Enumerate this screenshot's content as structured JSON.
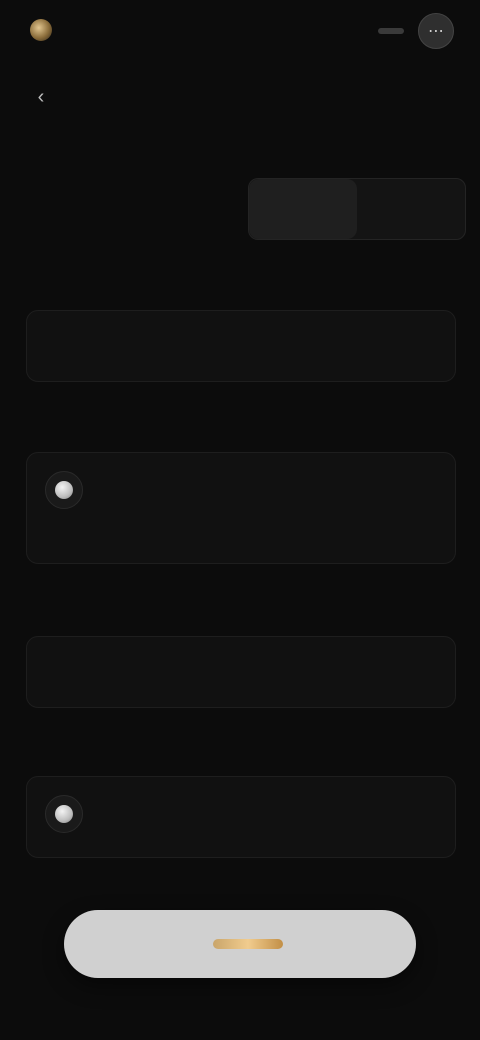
{
  "header": {
    "brand_text": "",
    "action_icon": "ellipsis-icon"
  },
  "nav": {
    "back_icon": "back-arrow-icon"
  },
  "page": {
    "title": ""
  },
  "toggle": {
    "left": "",
    "right": ""
  },
  "sections": {
    "s1_label": "",
    "s2_label": "",
    "s3_label": "",
    "s4_label": ""
  },
  "card1": {
    "left": ""
  },
  "card2": {
    "token": "",
    "amount": "",
    "sub_left": "",
    "sub_right": ""
  },
  "card3": {
    "left": ""
  },
  "card4": {
    "token": "",
    "amount": ""
  },
  "cta": {
    "label": "",
    "accent_color": "#f1cc8e"
  }
}
